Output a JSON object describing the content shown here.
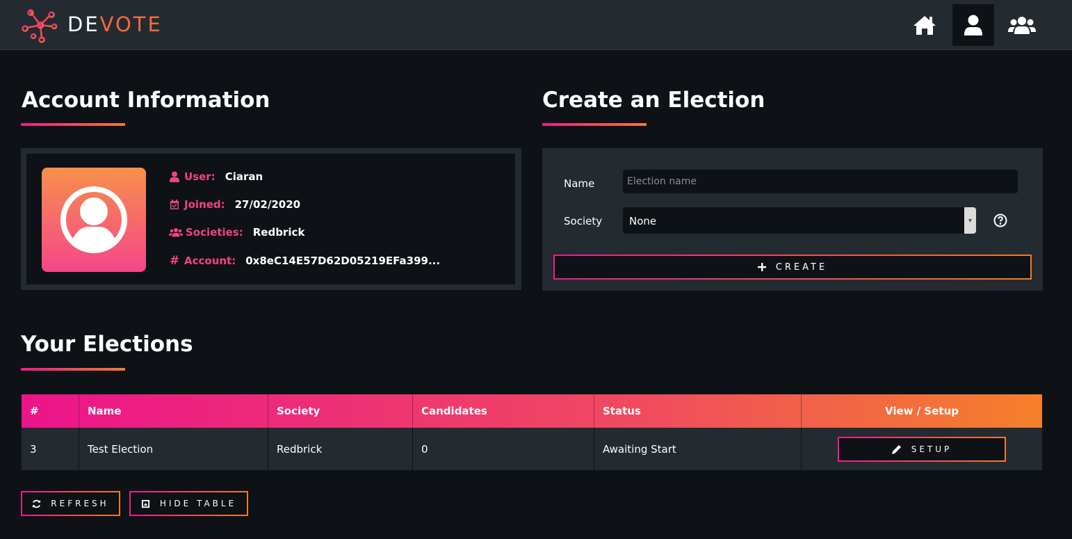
{
  "brand": {
    "part1": "DE",
    "part2": "VOTE"
  },
  "nav": {
    "icons": [
      "home-icon",
      "user-icon",
      "users-icon"
    ],
    "active": "user-icon"
  },
  "account": {
    "title": "Account Information",
    "user_label": "User:",
    "user_value": "Ciaran",
    "joined_label": "Joined:",
    "joined_value": "27/02/2020",
    "societies_label": "Societies:",
    "societies_value": "Redbrick",
    "account_label": "Account:",
    "account_value": "0x8eC14E57D62D05219EFa399..."
  },
  "create": {
    "title": "Create an Election",
    "name_label": "Name",
    "name_placeholder": "Election name",
    "society_label": "Society",
    "society_value": "None",
    "button": "CREATE"
  },
  "elections": {
    "title": "Your Elections",
    "columns": [
      "#",
      "Name",
      "Society",
      "Candidates",
      "Status",
      "View / Setup"
    ],
    "rows": [
      {
        "id": "3",
        "name": "Test Election",
        "society": "Redbrick",
        "candidates": "0",
        "status": "Awaiting Start",
        "action": "SETUP"
      }
    ],
    "refresh_button": "REFRESH",
    "hide_button": "HIDE TABLE"
  },
  "colors": {
    "accent_pink": "#ec1c8b",
    "accent_orange": "#f47a2a",
    "bg": "#0e1216",
    "panel": "#232b31",
    "label_pink": "#f0447e"
  }
}
